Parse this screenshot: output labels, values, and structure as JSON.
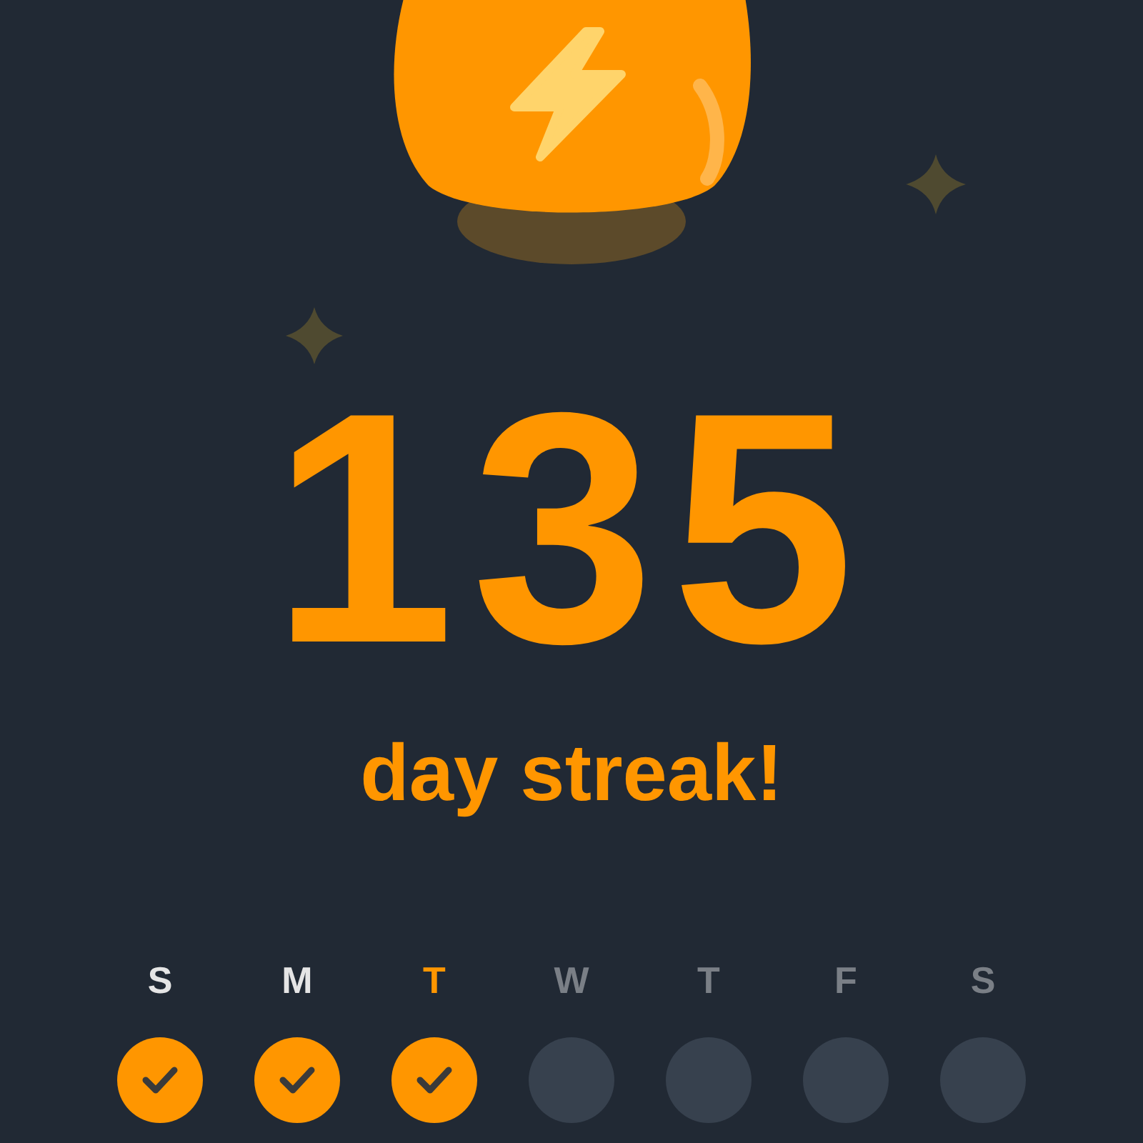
{
  "streak": {
    "count": "135",
    "label": "day streak!"
  },
  "days": [
    {
      "label": "S",
      "done": true,
      "today": false
    },
    {
      "label": "M",
      "done": true,
      "today": false
    },
    {
      "label": "T",
      "done": true,
      "today": true
    },
    {
      "label": "W",
      "done": false,
      "today": false
    },
    {
      "label": "T",
      "done": false,
      "today": false
    },
    {
      "label": "F",
      "done": false,
      "today": false
    },
    {
      "label": "S",
      "done": false,
      "today": false
    }
  ]
}
